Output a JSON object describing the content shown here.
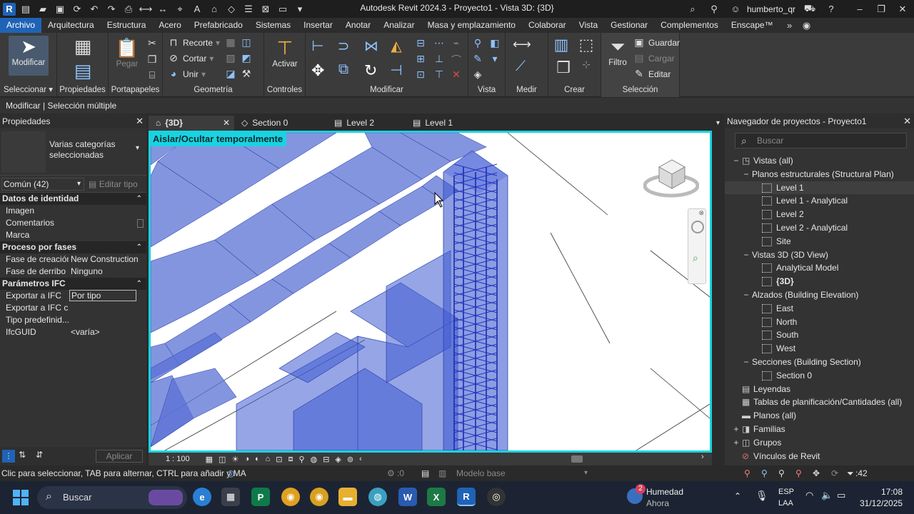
{
  "app": {
    "title": "Autodesk Revit 2024.3 - Proyecto1 - Vista 3D: {3D}",
    "user": "humberto_qr",
    "logo_letter": "R"
  },
  "menu": [
    "Archivo",
    "Arquitectura",
    "Estructura",
    "Acero",
    "Prefabricado",
    "Sistemas",
    "Insertar",
    "Anotar",
    "Analizar",
    "Masa y emplazamiento",
    "Colaborar",
    "Vista",
    "Gestionar",
    "Complementos",
    "Enscape™"
  ],
  "ribbon": {
    "modificar": "Modificar",
    "pegar": "Pegar",
    "recorte": "Recorte",
    "cortar": "Cortar",
    "unir": "Unir",
    "activar": "Activar",
    "filtro": "Filtro",
    "guardar": "Guardar",
    "cargar": "Cargar",
    "editar": "Editar",
    "panels": {
      "seleccionar": "Seleccionar",
      "propiedades": "Propiedades",
      "portapapeles": "Portapapeles",
      "geometria": "Geometría",
      "controles": "Controles",
      "modificar": "Modificar",
      "vista": "Vista",
      "medir": "Medir",
      "crear": "Crear",
      "seleccion": "Selección"
    }
  },
  "options_bar": "Modificar | Selección múltiple",
  "properties": {
    "title": "Propiedades",
    "type_name": "Varias categorías seleccionadas",
    "category_filter": "Común (42)",
    "edit_type": "Editar tipo",
    "sections": [
      {
        "name": "Datos de identidad",
        "rows": [
          {
            "k": "Imagen",
            "v": ""
          },
          {
            "k": "Comentarios",
            "v": ""
          },
          {
            "k": "Marca",
            "v": ""
          }
        ]
      },
      {
        "name": "Proceso por fases",
        "rows": [
          {
            "k": "Fase de creación",
            "v": "New Construction"
          },
          {
            "k": "Fase de derribo",
            "v": "Ninguno"
          }
        ]
      },
      {
        "name": "Parámetros IFC",
        "rows": [
          {
            "k": "Exportar a IFC",
            "v": "Por tipo"
          },
          {
            "k": "Exportar a IFC c...",
            "v": ""
          },
          {
            "k": "Tipo predefinid...",
            "v": ""
          },
          {
            "k": "IfcGUID",
            "v": "<varía>"
          }
        ]
      }
    ],
    "apply": "Aplicar"
  },
  "view_tabs": [
    "{3D}",
    "Section 0",
    "Level 2",
    "Level 1"
  ],
  "viewport": {
    "isolate_label": "Aislar/Ocultar temporalmente",
    "scale": "1 : 100"
  },
  "navigator": {
    "title": "Navegador de proyectos - Proyecto1",
    "search_placeholder": "Buscar",
    "tree": [
      {
        "label": "Vistas (all)",
        "level": 0,
        "toggle": "−",
        "icon": "views"
      },
      {
        "label": "Planos estructurales (Structural Plan)",
        "level": 1,
        "toggle": "−"
      },
      {
        "label": "Level 1",
        "level": 2,
        "icon": "view",
        "selected": true
      },
      {
        "label": "Level 1 - Analytical",
        "level": 2,
        "icon": "view"
      },
      {
        "label": "Level 2",
        "level": 2,
        "icon": "view"
      },
      {
        "label": "Level 2 - Analytical",
        "level": 2,
        "icon": "view"
      },
      {
        "label": "Site",
        "level": 2,
        "icon": "view"
      },
      {
        "label": "Vistas 3D (3D View)",
        "level": 1,
        "toggle": "−"
      },
      {
        "label": "Analytical Model",
        "level": 2,
        "icon": "view"
      },
      {
        "label": "{3D}",
        "level": 2,
        "icon": "view",
        "bold": true
      },
      {
        "label": "Alzados (Building Elevation)",
        "level": 1,
        "toggle": "−"
      },
      {
        "label": "East",
        "level": 2,
        "icon": "view"
      },
      {
        "label": "North",
        "level": 2,
        "icon": "view"
      },
      {
        "label": "South",
        "level": 2,
        "icon": "view"
      },
      {
        "label": "West",
        "level": 2,
        "icon": "view"
      },
      {
        "label": "Secciones (Building Section)",
        "level": 1,
        "toggle": "−"
      },
      {
        "label": "Section 0",
        "level": 2,
        "icon": "view"
      },
      {
        "label": "Leyendas",
        "level": 0,
        "icon": "legend"
      },
      {
        "label": "Tablas de planificación/Cantidades (all)",
        "level": 0,
        "icon": "table"
      },
      {
        "label": "Planos (all)",
        "level": 0,
        "icon": "sheet"
      },
      {
        "label": "Familias",
        "level": 0,
        "toggle": "+",
        "icon": "family"
      },
      {
        "label": "Grupos",
        "level": 0,
        "toggle": "+",
        "icon": "group"
      },
      {
        "label": "Vínculos de Revit",
        "level": 0,
        "icon": "link"
      }
    ]
  },
  "status": {
    "hint": "Clic para seleccionar, TAB para alternar, CTRL para añadir y MA",
    "count": ":0",
    "model": "Modelo base",
    "selection_count": ":42"
  },
  "taskbar": {
    "search": "Buscar",
    "weather_title": "Humedad",
    "weather_sub": "Ahora",
    "weather_badge": "2",
    "lang1": "ESP",
    "lang2": "LAA",
    "time": "17:08",
    "date": "31/12/2025"
  }
}
